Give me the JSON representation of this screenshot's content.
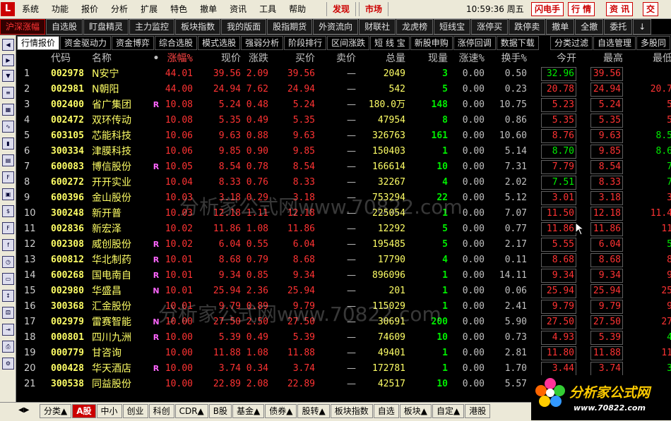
{
  "menubar": {
    "logo": "L",
    "items": [
      "系统",
      "功能",
      "报价",
      "分析",
      "扩展",
      "特色",
      "撤单",
      "资讯",
      "工具",
      "帮助"
    ],
    "discover": "发现",
    "market": "市场",
    "time": "10:59:36 周五",
    "buttons": [
      "闪电手",
      "行 情",
      "资 讯",
      "交"
    ]
  },
  "toolbar": {
    "items": [
      "沪深涨幅",
      "自选股",
      "盯盘精灵",
      "主力监控",
      "板块指数",
      "我的版面",
      "股指期货",
      "外资流向",
      "财联社",
      "龙虎榜",
      "短线宝",
      "涨停买",
      "跌停卖",
      "撤单",
      "全撤",
      "委托",
      "↓"
    ]
  },
  "subtabs": {
    "items": [
      "行情报价",
      "资金驱动力",
      "资金博弈",
      "综合选股",
      "模式选股",
      "强弱分析",
      "阶段排行",
      "区间涨跌",
      "短 线 宝",
      "新股申购",
      "涨停回调",
      "数据下载",
      "分类过滤",
      "自选管理",
      "多股同"
    ]
  },
  "table": {
    "headers": {
      "code": "代码",
      "name": "名称",
      "dot": "•",
      "pct": "涨幅%",
      "price": "现价",
      "chg": "涨跌",
      "bid": "买价",
      "ask": "卖价",
      "vol": "总量",
      "cur": "现量",
      "spd": "涨速%",
      "turn": "换手%",
      "open": "今开",
      "high": "最高",
      "low": "最低"
    },
    "rows": [
      {
        "idx": "1",
        "code": "002978",
        "name": "N安宁",
        "flag": "",
        "pct": "44.01",
        "price": "39.56",
        "chg": "2.09",
        "bid": "39.56",
        "ask": "—",
        "vol": "2049",
        "cur": "3",
        "spd": "0.00",
        "turn": "0.50",
        "open": "32.96",
        "high": "39.56",
        "low": ""
      },
      {
        "idx": "2",
        "code": "002981",
        "name": "N朝阳",
        "flag": "",
        "pct": "44.00",
        "price": "24.94",
        "chg": "7.62",
        "bid": "24.94",
        "ask": "—",
        "vol": "542",
        "cur": "5",
        "spd": "0.00",
        "turn": "0.23",
        "open": "20.78",
        "high": "24.94",
        "low": "20.7"
      },
      {
        "idx": "3",
        "code": "002400",
        "name": "省广集团",
        "flag": "R",
        "pct": "10.08",
        "price": "5.24",
        "chg": "0.48",
        "bid": "5.24",
        "ask": "—",
        "vol": "180.0万",
        "cur": "148",
        "spd": "0.00",
        "turn": "10.75",
        "open": "5.23",
        "high": "5.24",
        "low": "5"
      },
      {
        "idx": "4",
        "code": "002472",
        "name": "双环传动",
        "flag": "",
        "pct": "10.08",
        "price": "5.35",
        "chg": "0.49",
        "bid": "5.35",
        "ask": "—",
        "vol": "47954",
        "cur": "8",
        "spd": "0.00",
        "turn": "0.86",
        "open": "5.35",
        "high": "5.35",
        "low": "5"
      },
      {
        "idx": "5",
        "code": "603105",
        "name": "芯能科技",
        "flag": "",
        "pct": "10.06",
        "price": "9.63",
        "chg": "0.88",
        "bid": "9.63",
        "ask": "—",
        "vol": "326763",
        "cur": "161",
        "spd": "0.00",
        "turn": "10.60",
        "open": "8.76",
        "high": "9.63",
        "low": "8.5"
      },
      {
        "idx": "6",
        "code": "300334",
        "name": "津膜科技",
        "flag": "",
        "pct": "10.06",
        "price": "9.85",
        "chg": "0.90",
        "bid": "9.85",
        "ask": "—",
        "vol": "150403",
        "cur": "1",
        "spd": "0.00",
        "turn": "5.14",
        "open": "8.70",
        "high": "9.85",
        "low": "8.6"
      },
      {
        "idx": "7",
        "code": "600083",
        "name": "博信股份",
        "flag": "R",
        "pct": "10.05",
        "price": "8.54",
        "chg": "0.78",
        "bid": "8.54",
        "ask": "—",
        "vol": "166614",
        "cur": "10",
        "spd": "0.00",
        "turn": "7.31",
        "open": "7.79",
        "high": "8.54",
        "low": "7"
      },
      {
        "idx": "8",
        "code": "600272",
        "name": "开开实业",
        "flag": "",
        "pct": "10.04",
        "price": "8.33",
        "chg": "0.76",
        "bid": "8.33",
        "ask": "—",
        "vol": "32267",
        "cur": "4",
        "spd": "0.00",
        "turn": "2.02",
        "open": "7.51",
        "high": "8.33",
        "low": "7"
      },
      {
        "idx": "9",
        "code": "600396",
        "name": "金山股份",
        "flag": "",
        "pct": "10.03",
        "price": "3.18",
        "chg": "0.29",
        "bid": "3.18",
        "ask": "—",
        "vol": "753294",
        "cur": "22",
        "spd": "0.00",
        "turn": "5.12",
        "open": "3.01",
        "high": "3.18",
        "low": "3"
      },
      {
        "idx": "10",
        "code": "300248",
        "name": "新开普",
        "flag": "",
        "pct": "10.03",
        "price": "12.18",
        "chg": "1.11",
        "bid": "12.18",
        "ask": "—",
        "vol": "225054",
        "cur": "1",
        "spd": "0.00",
        "turn": "7.07",
        "open": "11.50",
        "high": "12.18",
        "low": "11.4"
      },
      {
        "idx": "11",
        "code": "002836",
        "name": "新宏泽",
        "flag": "",
        "pct": "10.02",
        "price": "11.86",
        "chg": "1.08",
        "bid": "11.86",
        "ask": "—",
        "vol": "12292",
        "cur": "5",
        "spd": "0.00",
        "turn": "0.77",
        "open": "11.86",
        "high": "11.86",
        "low": "11"
      },
      {
        "idx": "12",
        "code": "002308",
        "name": "威创股份",
        "flag": "R",
        "pct": "10.02",
        "price": "6.04",
        "chg": "0.55",
        "bid": "6.04",
        "ask": "—",
        "vol": "195485",
        "cur": "5",
        "spd": "0.00",
        "turn": "2.17",
        "open": "5.55",
        "high": "6.04",
        "low": "5"
      },
      {
        "idx": "13",
        "code": "600812",
        "name": "华北制药",
        "flag": "R",
        "pct": "10.01",
        "price": "8.68",
        "chg": "0.79",
        "bid": "8.68",
        "ask": "—",
        "vol": "17790",
        "cur": "4",
        "spd": "0.00",
        "turn": "0.11",
        "open": "8.68",
        "high": "8.68",
        "low": "8"
      },
      {
        "idx": "14",
        "code": "600268",
        "name": "国电南自",
        "flag": "R",
        "pct": "10.01",
        "price": "9.34",
        "chg": "0.85",
        "bid": "9.34",
        "ask": "—",
        "vol": "896096",
        "cur": "1",
        "spd": "0.00",
        "turn": "14.11",
        "open": "9.34",
        "high": "9.34",
        "low": "9"
      },
      {
        "idx": "15",
        "code": "002980",
        "name": "华盛昌",
        "flag": "N",
        "pct": "10.01",
        "price": "25.94",
        "chg": "2.36",
        "bid": "25.94",
        "ask": "—",
        "vol": "201",
        "cur": "1",
        "spd": "0.00",
        "turn": "0.06",
        "open": "25.94",
        "high": "25.94",
        "low": "25"
      },
      {
        "idx": "16",
        "code": "300368",
        "name": "汇金股份",
        "flag": "",
        "pct": "10.01",
        "price": "9.79",
        "chg": "0.89",
        "bid": "9.79",
        "ask": "—",
        "vol": "115029",
        "cur": "1",
        "spd": "0.00",
        "turn": "2.41",
        "open": "9.79",
        "high": "9.79",
        "low": "9"
      },
      {
        "idx": "17",
        "code": "002979",
        "name": "雷赛智能",
        "flag": "N",
        "pct": "10.00",
        "price": "27.50",
        "chg": "2.50",
        "bid": "27.50",
        "ask": "—",
        "vol": "30691",
        "cur": "200",
        "spd": "0.00",
        "turn": "5.90",
        "open": "27.50",
        "high": "27.50",
        "low": "27"
      },
      {
        "idx": "18",
        "code": "000801",
        "name": "四川九洲",
        "flag": "R",
        "pct": "10.00",
        "price": "5.39",
        "chg": "0.49",
        "bid": "5.39",
        "ask": "—",
        "vol": "74609",
        "cur": "10",
        "spd": "0.00",
        "turn": "0.73",
        "open": "4.93",
        "high": "5.39",
        "low": "4"
      },
      {
        "idx": "19",
        "code": "000779",
        "name": "甘咨询",
        "flag": "",
        "pct": "10.00",
        "price": "11.88",
        "chg": "1.08",
        "bid": "11.88",
        "ask": "—",
        "vol": "49401",
        "cur": "1",
        "spd": "0.00",
        "turn": "2.81",
        "open": "11.80",
        "high": "11.88",
        "low": "11"
      },
      {
        "idx": "20",
        "code": "000428",
        "name": "华天酒店",
        "flag": "R",
        "pct": "10.00",
        "price": "3.74",
        "chg": "0.34",
        "bid": "3.74",
        "ask": "—",
        "vol": "172781",
        "cur": "1",
        "spd": "0.00",
        "turn": "1.70",
        "open": "3.44",
        "high": "3.74",
        "low": "3"
      },
      {
        "idx": "21",
        "code": "300538",
        "name": "同益股份",
        "flag": "",
        "pct": "10.00",
        "price": "22.89",
        "chg": "2.08",
        "bid": "22.89",
        "ask": "—",
        "vol": "42517",
        "cur": "10",
        "spd": "0.00",
        "turn": "5.57",
        "open": "",
        "high": "",
        "low": ""
      }
    ]
  },
  "watermark": {
    "line1": "分析家公式网www.70822.com",
    "line2": "分析家公式网www.70822.com"
  },
  "bottombar": {
    "nav": "◀▶",
    "tabs": [
      "分类▲",
      "A股",
      "中小",
      "创业",
      "科创",
      "CDR▲",
      "B股",
      "基金▲",
      "债券▲",
      "股转▲",
      "板块指数",
      "自选",
      "板块▲",
      "自定▲",
      "港股"
    ]
  },
  "corner": {
    "brand": "分析家公式网",
    "url": "www.70822.com"
  },
  "colors": {
    "up": "#ff3333",
    "down": "#00ee00",
    "code": "#ffff66",
    "background": "#000000"
  }
}
